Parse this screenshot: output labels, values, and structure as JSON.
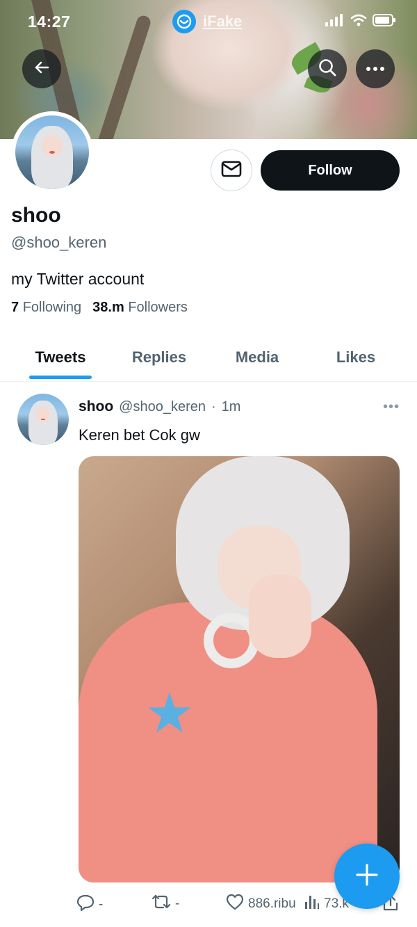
{
  "status_bar": {
    "time": "14:27",
    "app_name": "iFake",
    "icons": [
      "signal-icon",
      "wifi-icon",
      "battery-icon"
    ]
  },
  "header": {
    "back_icon": "arrow-left-icon",
    "search_icon": "search-icon",
    "more_icon": "more-horizontal-icon"
  },
  "profile": {
    "display_name": "shoo",
    "handle": "@shoo_keren",
    "bio": "my Twitter account",
    "following_count": "7",
    "following_label": "Following",
    "followers_count": "38.m",
    "followers_label": "Followers",
    "follow_button_label": "Follow",
    "message_icon": "mail-icon"
  },
  "tabs": [
    {
      "label": "Tweets",
      "active": true
    },
    {
      "label": "Replies",
      "active": false
    },
    {
      "label": "Media",
      "active": false
    },
    {
      "label": "Likes",
      "active": false
    }
  ],
  "tweet": {
    "name": "shoo",
    "handle": "@shoo_keren",
    "separator": "·",
    "time": "1m",
    "more": "•••",
    "text": "Keren bet Cok gw",
    "actions": {
      "reply_count": "-",
      "retweet_count": "-",
      "like_count": "886.ribu",
      "views_count": "73.k"
    }
  },
  "colors": {
    "accent": "#1d9bf0",
    "text_primary": "#0f1419",
    "text_secondary": "#536471",
    "follow_button": "#0f1419"
  }
}
